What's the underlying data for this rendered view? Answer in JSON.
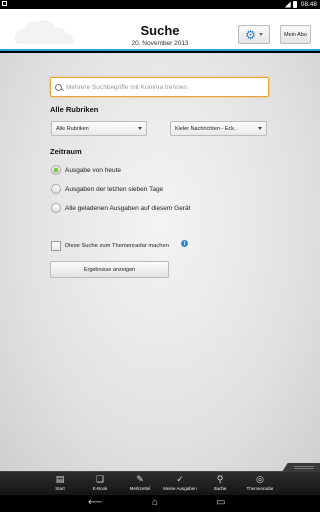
{
  "status_bar": {
    "time": "08:48"
  },
  "header": {
    "title": "Suche",
    "date": "20. November 2013",
    "settings_icon": "gear-icon",
    "abo_label": "Mein Abo",
    "accent_color": "#29a3d6"
  },
  "search": {
    "placeholder": "Mehrere Suchbegriffe mit Komma trennen.",
    "value": ""
  },
  "rubriken": {
    "heading": "Alle Rubriken",
    "select1": "Alle Rubriken",
    "select2": "Kieler Nachrichten - Eck.."
  },
  "zeitraum": {
    "heading": "Zeitraum",
    "options": [
      {
        "label": "Ausgabe von heute",
        "checked": true
      },
      {
        "label": "Ausgaben der letzten sieben Tage",
        "checked": false
      },
      {
        "label": "Alle geladenen Ausgaben auf diesem Gerät",
        "checked": false
      }
    ]
  },
  "themenradar": {
    "label": "Diese Suche zum Themenradar machen",
    "checked": false,
    "info": "i"
  },
  "results_button": "Ergebnisse anzeigen",
  "tabs": [
    {
      "label": "Start",
      "icon": "newspaper-icon",
      "glyph": "▤"
    },
    {
      "label": "E-Book",
      "icon": "ebook-icon",
      "glyph": "❏"
    },
    {
      "label": "Merkzettel",
      "icon": "bookmark-list-icon",
      "glyph": "✎"
    },
    {
      "label": "Meine Ausgaben",
      "icon": "checkmark-icon",
      "glyph": "✓"
    },
    {
      "label": "Suche",
      "icon": "search-icon",
      "glyph": "⚲",
      "active": true
    },
    {
      "label": "Themenradar",
      "icon": "radar-icon",
      "glyph": "◎"
    }
  ],
  "navbar": {
    "back": "back-icon",
    "home": "home-icon",
    "recent": "recent-apps-icon"
  }
}
